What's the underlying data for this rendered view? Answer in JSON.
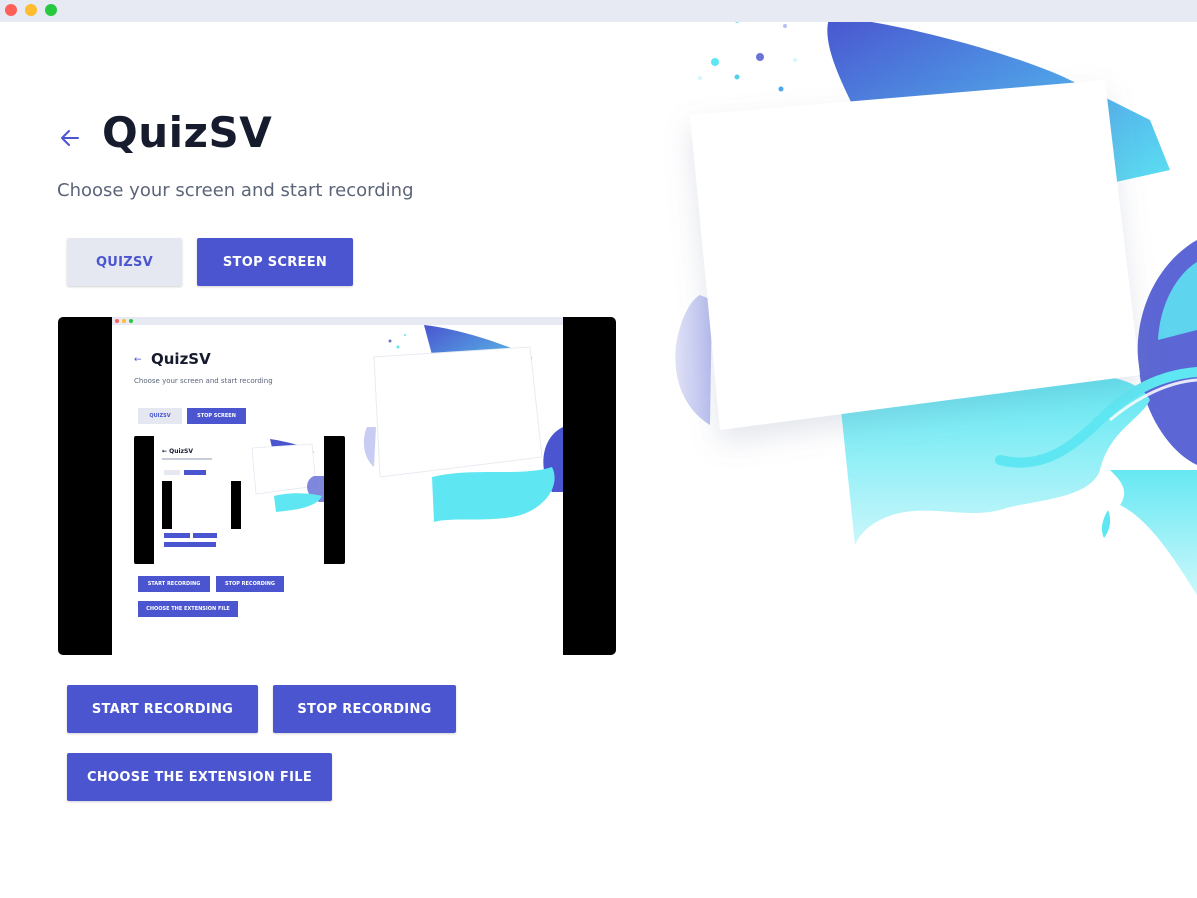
{
  "window": {
    "controls": [
      "close",
      "minimize",
      "maximize"
    ]
  },
  "header": {
    "back_icon": "arrow-left-icon",
    "title": "QuizSV",
    "subtitle": "Choose your screen and start recording"
  },
  "source_buttons": {
    "app_source_label": "QUIZSV",
    "stop_screen_label": "STOP SCREEN"
  },
  "recording_buttons": {
    "start_label": "START RECORDING",
    "stop_label": "STOP RECORDING",
    "extension_label": "CHOOSE THE EXTENSION FILE"
  },
  "colors": {
    "accent": "#4a55cf",
    "title": "#161b2e",
    "subtitle": "#5b6478",
    "secondary_bg": "#e5e8f0",
    "titlebar": "#e7eaf2",
    "cyan": "#5ee7f2"
  }
}
